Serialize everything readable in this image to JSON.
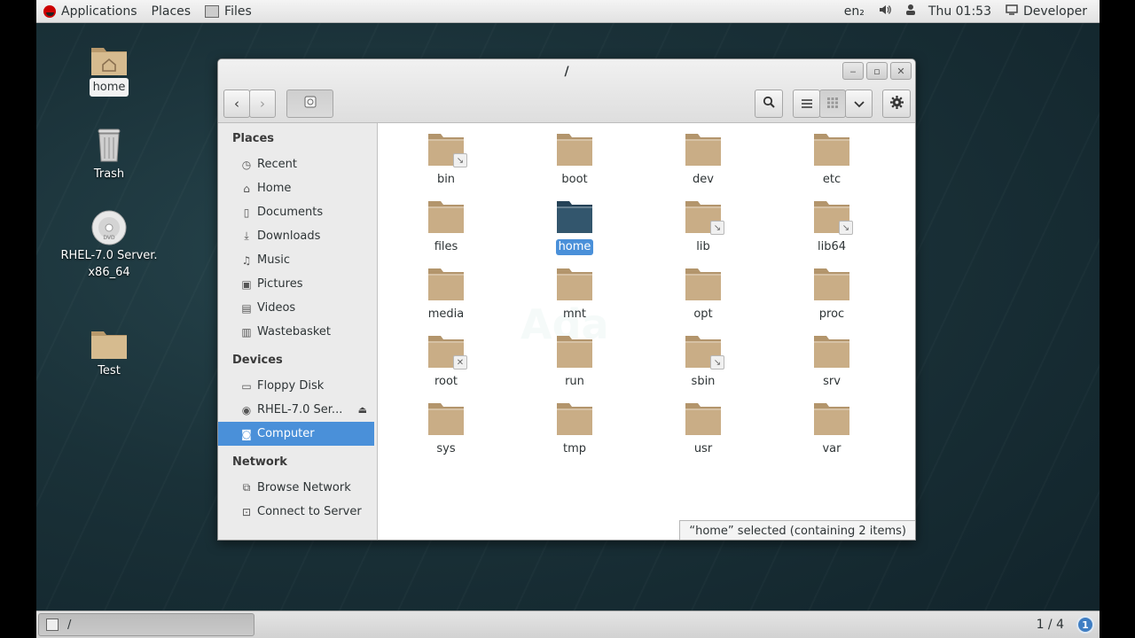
{
  "top_panel": {
    "applications": "Applications",
    "places": "Places",
    "files": "Files",
    "keyboard": "en₂",
    "clock": "Thu 01:53",
    "user": "Developer"
  },
  "desktop": {
    "icons": [
      {
        "label": "home",
        "selected": true
      },
      {
        "label": "Trash"
      },
      {
        "label": "RHEL-7.0 Server.",
        "label2": "x86_64"
      },
      {
        "label": "Test"
      }
    ]
  },
  "window": {
    "title": "/",
    "status": "“home” selected  (containing 2 items)",
    "watermark": "Ada"
  },
  "sidebar": {
    "places_header": "Places",
    "places": [
      {
        "label": "Recent",
        "icon": "clock-icon"
      },
      {
        "label": "Home",
        "icon": "home-icon"
      },
      {
        "label": "Documents",
        "icon": "document-icon"
      },
      {
        "label": "Downloads",
        "icon": "download-icon"
      },
      {
        "label": "Music",
        "icon": "music-icon"
      },
      {
        "label": "Pictures",
        "icon": "camera-icon"
      },
      {
        "label": "Videos",
        "icon": "film-icon"
      },
      {
        "label": "Wastebasket",
        "icon": "trash-icon"
      }
    ],
    "devices_header": "Devices",
    "devices": [
      {
        "label": "Floppy Disk",
        "icon": "floppy-icon"
      },
      {
        "label": "RHEL-7.0 Ser...",
        "icon": "disc-icon"
      },
      {
        "label": "Computer",
        "icon": "computer-icon",
        "active": true
      }
    ],
    "network_header": "Network",
    "network": [
      {
        "label": "Browse Network",
        "icon": "network-icon"
      },
      {
        "label": "Connect to Server",
        "icon": "server-icon"
      }
    ]
  },
  "folders": [
    {
      "label": "bin",
      "badge": "link"
    },
    {
      "label": "boot"
    },
    {
      "label": "dev"
    },
    {
      "label": "etc"
    },
    {
      "label": "files"
    },
    {
      "label": "home",
      "selected": true
    },
    {
      "label": "lib",
      "badge": "link"
    },
    {
      "label": "lib64",
      "badge": "link"
    },
    {
      "label": "media"
    },
    {
      "label": "mnt"
    },
    {
      "label": "opt"
    },
    {
      "label": "proc"
    },
    {
      "label": "root",
      "badge": "locked"
    },
    {
      "label": "run"
    },
    {
      "label": "sbin",
      "badge": "link"
    },
    {
      "label": "srv"
    },
    {
      "label": "sys"
    },
    {
      "label": "tmp"
    },
    {
      "label": "usr"
    },
    {
      "label": "var"
    }
  ],
  "bottom_panel": {
    "task_label": "/",
    "workspace": "1 / 4",
    "notifications": "1"
  },
  "colors": {
    "accent": "#4a90d9",
    "folder": "#c9ad86",
    "folder_selected": "#33566d"
  }
}
